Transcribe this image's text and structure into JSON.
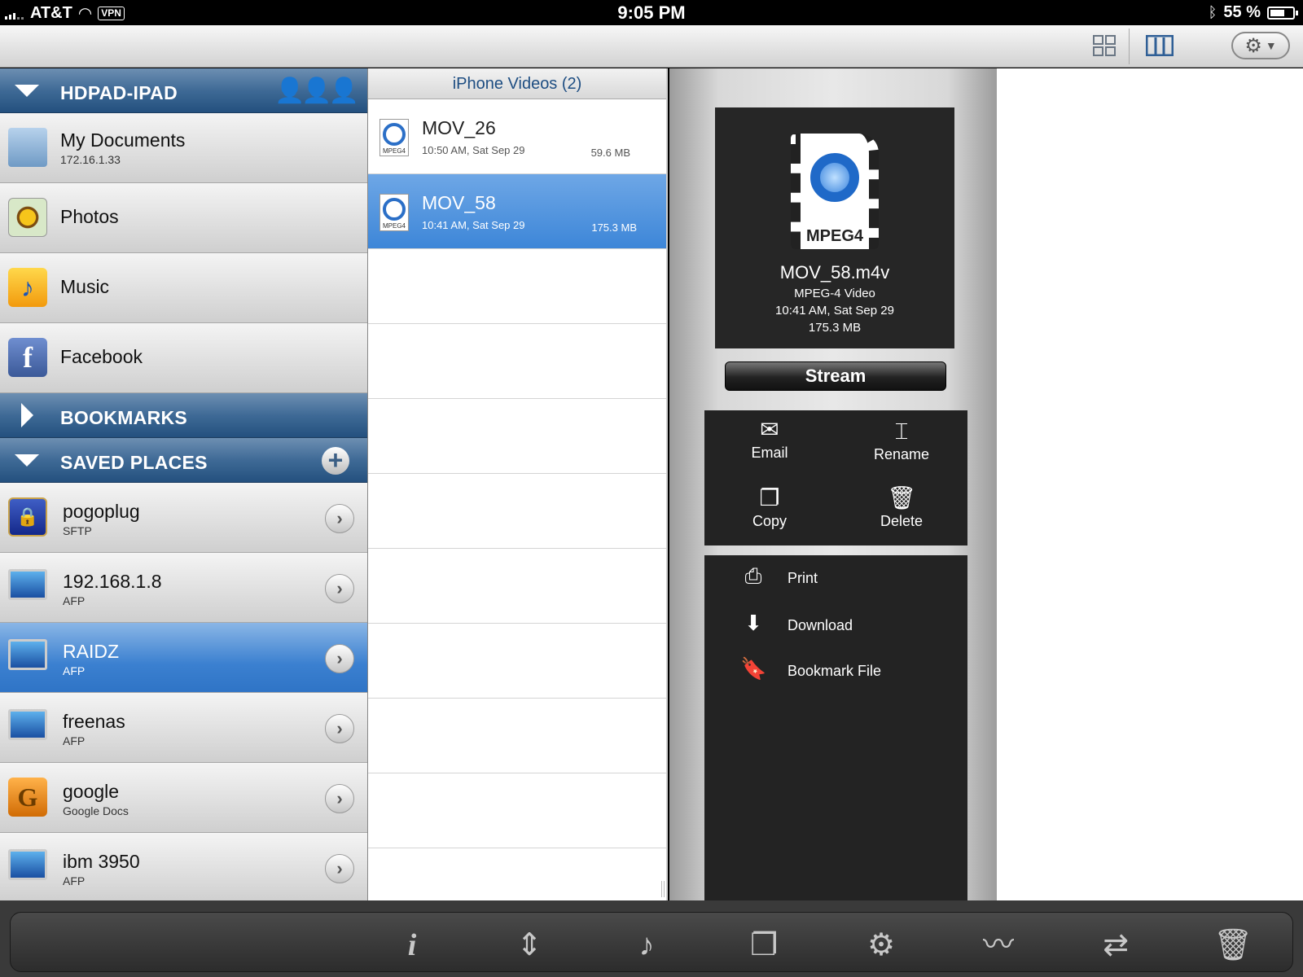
{
  "status": {
    "carrier": "AT&T",
    "vpn": "VPN",
    "time": "9:05 PM",
    "battery": "55 %",
    "battery_level": 0.55
  },
  "topbar": {
    "icons": [
      "grid-view-icon",
      "column-view-icon",
      "gear-icon"
    ]
  },
  "sidebar": {
    "device": {
      "title": "HDPAD-IPAD"
    },
    "items": [
      {
        "title": "My Documents",
        "sub": "172.16.1.33",
        "icon": "folder-icon"
      },
      {
        "title": "Photos",
        "sub": "",
        "icon": "photos-icon"
      },
      {
        "title": "Music",
        "sub": "",
        "icon": "music-icon"
      },
      {
        "title": "Facebook",
        "sub": "",
        "icon": "facebook-icon"
      }
    ],
    "bookmarks": {
      "title": "BOOKMARKS"
    },
    "saved": {
      "title": "SAVED PLACES"
    },
    "places": [
      {
        "title": "pogoplug",
        "sub": "SFTP",
        "icon": "lock-icon"
      },
      {
        "title": "192.168.1.8",
        "sub": "AFP",
        "icon": "imac-icon"
      },
      {
        "title": "RAIDZ",
        "sub": "AFP",
        "icon": "imac-icon"
      },
      {
        "title": "freenas",
        "sub": "AFP",
        "icon": "imac-icon"
      },
      {
        "title": "google",
        "sub": "Google Docs",
        "icon": "google-drive-icon"
      },
      {
        "title": "ibm 3950",
        "sub": "AFP",
        "icon": "imac-icon"
      }
    ]
  },
  "list": {
    "header": "iPhone Videos (2)",
    "files": [
      {
        "name": "MOV_26",
        "date": "10:50 AM, Sat Sep 29",
        "size": "59.6  MB",
        "badge": "MPEG4"
      },
      {
        "name": "MOV_58",
        "date": "10:41 AM, Sat Sep 29",
        "size": "175.3  MB",
        "badge": "MPEG4"
      }
    ]
  },
  "detail": {
    "badge": "MPEG4",
    "filename": "MOV_58.m4v",
    "type": "MPEG-4 Video",
    "date": "10:41 AM, Sat Sep 29",
    "size": "175.3  MB",
    "stream": "Stream",
    "actions": {
      "email": "Email",
      "rename": "Rename",
      "copy": "Copy",
      "delete": "Delete"
    },
    "menu": {
      "print": "Print",
      "download": "Download",
      "bookmark": "Bookmark File"
    }
  },
  "bottombar": {
    "icons": [
      "info-icon",
      "sort-icon",
      "music-note-icon",
      "documents-icon",
      "settings-icon",
      "activity-icon",
      "transfer-icon",
      "trash-icon"
    ]
  }
}
